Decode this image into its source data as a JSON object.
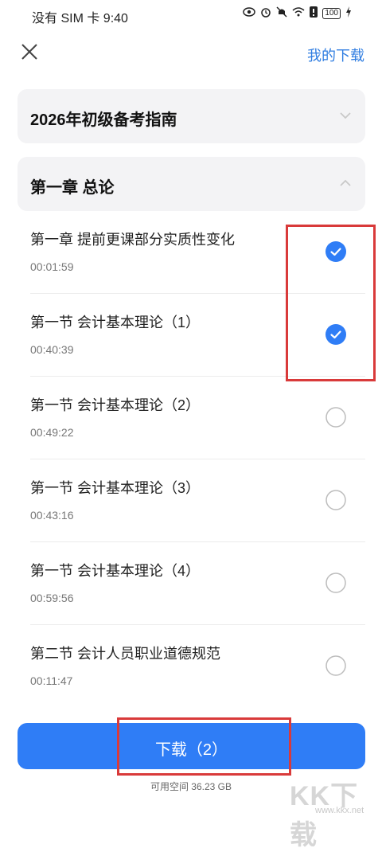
{
  "status_bar": {
    "carrier": "没有 SIM 卡",
    "time": "9:40",
    "battery": "100"
  },
  "header": {
    "my_downloads": "我的下载"
  },
  "sections": [
    {
      "title": "2026年初级备考指南",
      "expanded": false
    },
    {
      "title": "第一章 总论",
      "expanded": true
    }
  ],
  "lessons": [
    {
      "title": "第一章 提前更课部分实质性变化",
      "duration": "00:01:59",
      "selected": true
    },
    {
      "title": "第一节 会计基本理论（1）",
      "duration": "00:40:39",
      "selected": true
    },
    {
      "title": "第一节 会计基本理论（2）",
      "duration": "00:49:22",
      "selected": false
    },
    {
      "title": "第一节 会计基本理论（3）",
      "duration": "00:43:16",
      "selected": false
    },
    {
      "title": "第一节 会计基本理论（4）",
      "duration": "00:59:56",
      "selected": false
    },
    {
      "title": "第二节 会计人员职业道德规范",
      "duration": "00:11:47",
      "selected": false
    }
  ],
  "footer": {
    "download_label": "下载（2）",
    "available_space": "可用空间 36.23 GB"
  },
  "watermark": {
    "text": "KK下载",
    "url": "www.kkx.net"
  },
  "colors": {
    "accent": "#2f7df6",
    "link": "#2f7de1",
    "highlight": "#d93a3a"
  }
}
